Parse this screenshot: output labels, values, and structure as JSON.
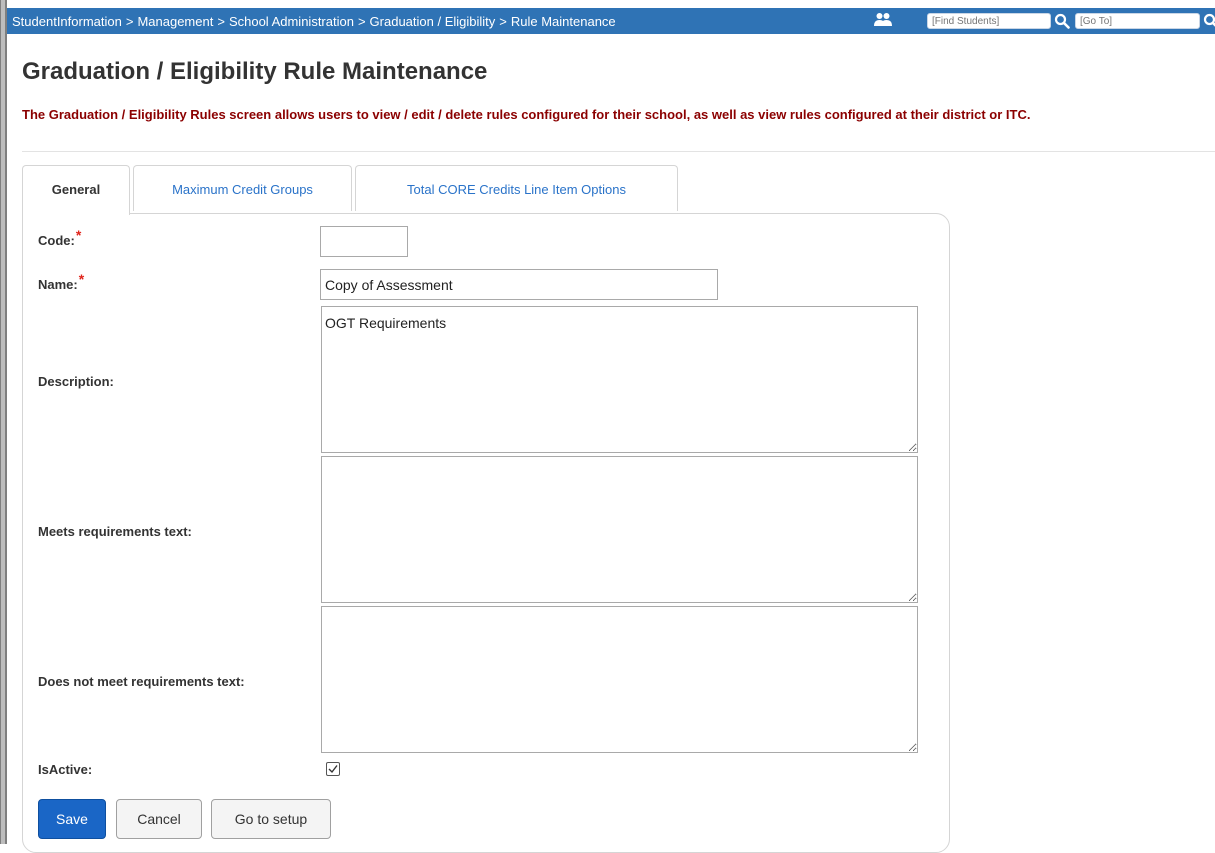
{
  "breadcrumb": {
    "items": [
      "StudentInformation",
      "Management",
      "School Administration",
      "Graduation / Eligibility",
      "Rule Maintenance"
    ],
    "separator": ">"
  },
  "topbar": {
    "find_students_placeholder": "[Find Students]",
    "goto_placeholder": "[Go To]",
    "people_icon": "people-icon",
    "search_icon": "search-icon",
    "background_color": "#2f73b5"
  },
  "page": {
    "title": "Graduation / Eligibility Rule Maintenance",
    "description": "The Graduation / Eligibility Rules screen allows users to view / edit / delete rules configured for their school, as well as view rules configured at their district or ITC.",
    "description_color": "#8b0000"
  },
  "tabs": [
    {
      "label": "General",
      "active": true
    },
    {
      "label": "Maximum Credit Groups",
      "active": false
    },
    {
      "label": "Total CORE Credits Line Item Options",
      "active": false
    }
  ],
  "form": {
    "code": {
      "label": "Code:",
      "required_mark": "*",
      "value": ""
    },
    "name": {
      "label": "Name:",
      "required_mark": "*",
      "value": "Copy of Assessment"
    },
    "description": {
      "label": "Description:",
      "value": "OGT Requirements"
    },
    "meets_text": {
      "label": "Meets requirements text:",
      "value": ""
    },
    "not_meets_text": {
      "label": "Does not meet requirements text:",
      "value": ""
    },
    "is_active": {
      "label": "IsActive:",
      "checked": true
    }
  },
  "buttons": {
    "save": "Save",
    "cancel": "Cancel",
    "goto_setup": "Go to setup"
  }
}
